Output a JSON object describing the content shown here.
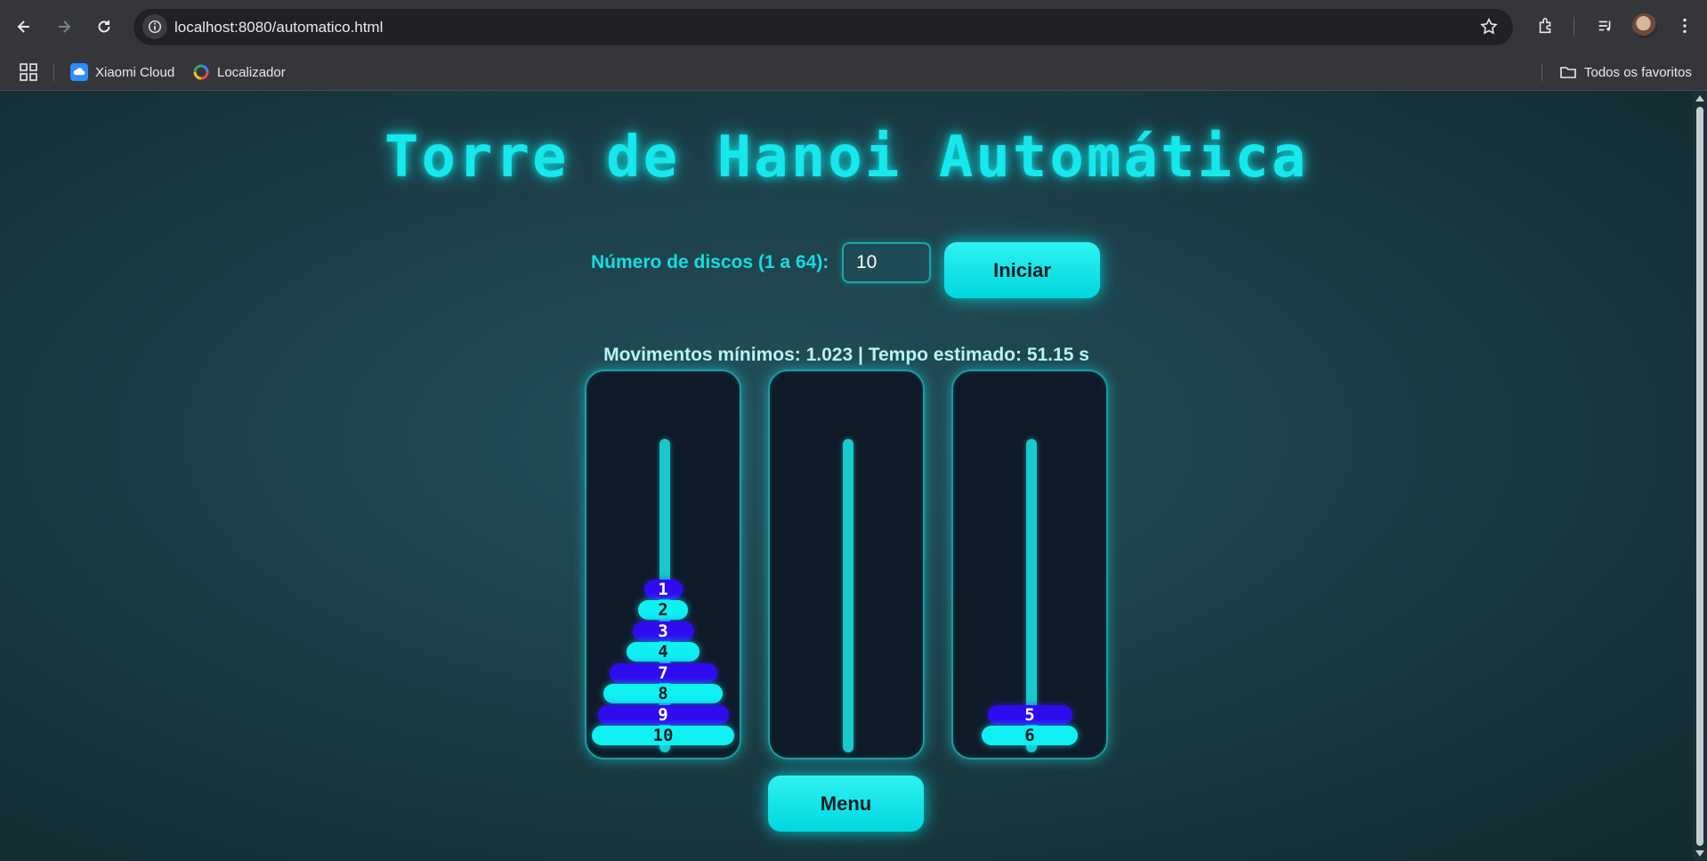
{
  "browser": {
    "url": "localhost:8080/automatico.html",
    "bookmarks": [
      {
        "label": "Xiaomi Cloud",
        "icon": "cloud-icon",
        "color": "#2f8cff"
      },
      {
        "label": "Localizador",
        "icon": "location-icon",
        "color": "#e8a33a"
      }
    ],
    "all_bookmarks_label": "Todos os favoritos"
  },
  "page": {
    "title": "Torre de Hanoi Automática",
    "disc_count_label": "Número de discos (1 a 64):",
    "disc_count_value": "10",
    "start_button": "Iniciar",
    "info": "Movimentos mínimos: 1.023 | Tempo estimado: 51.15 s",
    "menu_button": "Menu"
  },
  "towers": [
    {
      "name": "tower-a",
      "disks": [
        {
          "label": "1",
          "size": 1,
          "color": "blue"
        },
        {
          "label": "2",
          "size": 2,
          "color": "cyan"
        },
        {
          "label": "3",
          "size": 3,
          "color": "blue"
        },
        {
          "label": "4",
          "size": 4,
          "color": "cyan"
        },
        {
          "label": "7",
          "size": 7,
          "color": "blue"
        },
        {
          "label": "8",
          "size": 8,
          "color": "cyan"
        },
        {
          "label": "9",
          "size": 9,
          "color": "blue"
        },
        {
          "label": "10",
          "size": 10,
          "color": "cyan"
        }
      ]
    },
    {
      "name": "tower-b",
      "disks": []
    },
    {
      "name": "tower-c",
      "disks": [
        {
          "label": "5",
          "size": 5,
          "color": "blue"
        },
        {
          "label": "6",
          "size": 6,
          "color": "cyan"
        }
      ]
    }
  ],
  "colors": {
    "accent": "#16e8ec",
    "disk_cyan": "#0ff0f2",
    "disk_blue": "#2f0cf0"
  }
}
